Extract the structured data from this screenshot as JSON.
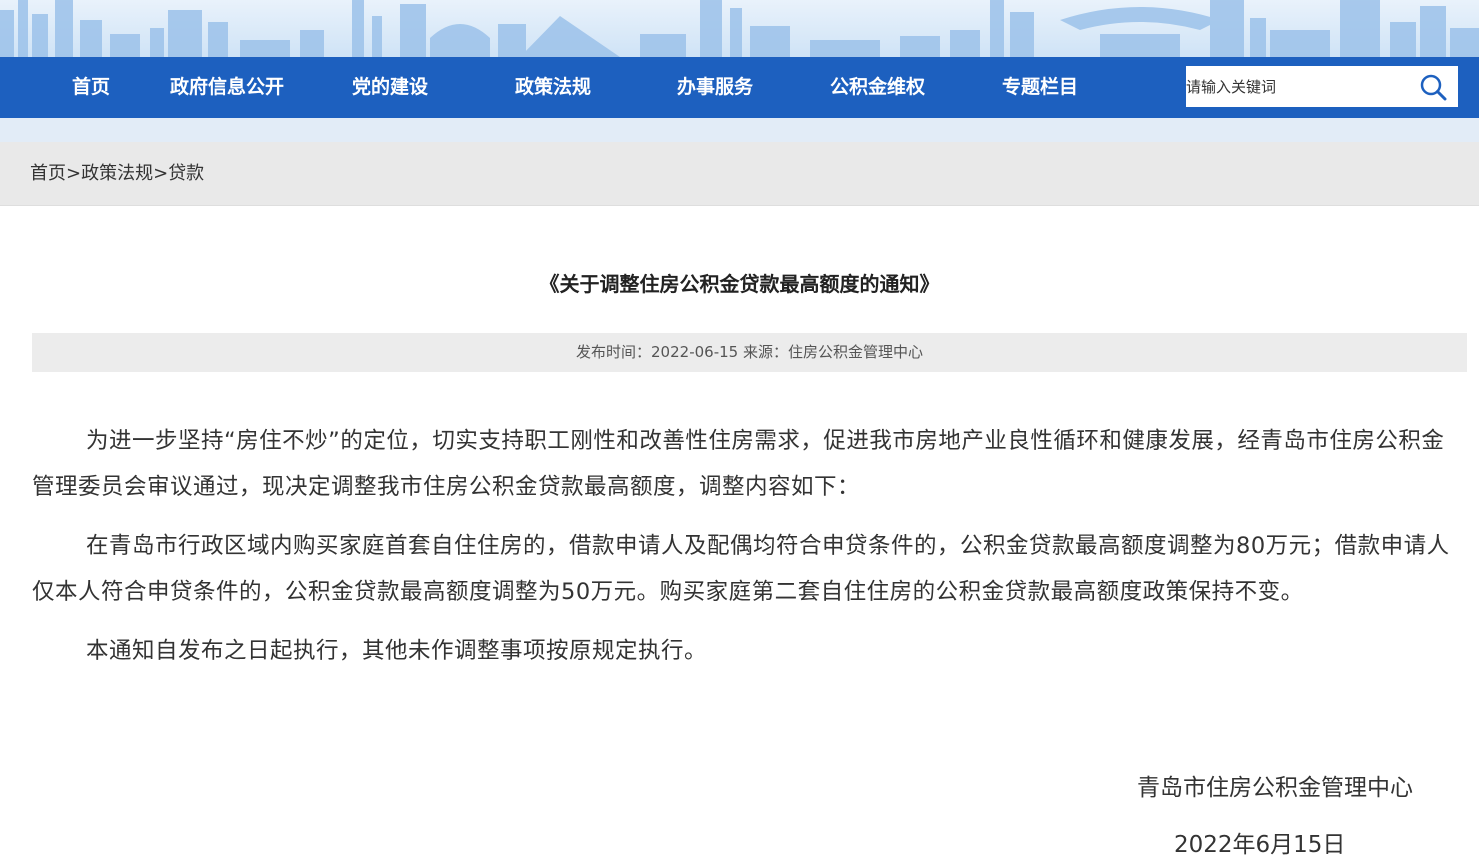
{
  "nav": {
    "items": [
      "首页",
      "政府信息公开",
      "党的建设",
      "政策法规",
      "办事服务",
      "公积金维权",
      "专题栏目"
    ],
    "search_placeholder": "请输入关键词",
    "search_icon": "magnifier-icon",
    "color": "#1d60bf"
  },
  "breadcrumb": {
    "home": "首页",
    "sep": ">",
    "section": "政策法规",
    "current": "贷款"
  },
  "article": {
    "title": "《关于调整住房公积金贷款最高额度的通知》",
    "meta": "发布时间：2022-06-15 来源：住房公积金管理中心",
    "paragraphs": [
      "为进一步坚持“房住不炒”的定位，切实支持职工刚性和改善性住房需求，促进我市房地产业良性循环和健康发展，经青岛市住房公积金管理委员会审议通过，现决定调整我市住房公积金贷款最高额度，调整内容如下：",
      "在青岛市行政区域内购买家庭首套自住住房的，借款申请人及配偶均符合申贷条件的，公积金贷款最高额度调整为80万元；借款申请人仅本人符合申贷条件的，公积金贷款最高额度调整为50万元。购买家庭第二套自住住房的公积金贷款最高额度政策保持不变。",
      "本通知自发布之日起执行，其他未作调整事项按原规定执行。"
    ],
    "signature": "青岛市住房公积金管理中心",
    "date": "2022年6月15日"
  }
}
